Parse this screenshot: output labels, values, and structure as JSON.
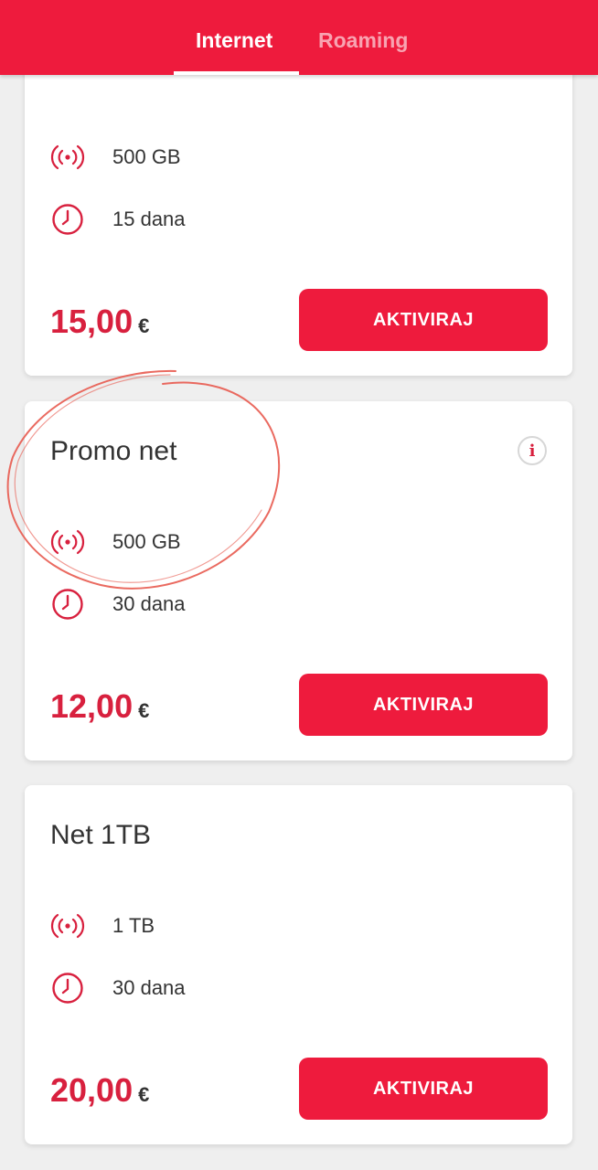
{
  "header": {
    "tabs": [
      {
        "label": "Internet",
        "active": true
      },
      {
        "label": "Roaming",
        "active": false
      }
    ]
  },
  "colors": {
    "brand": "#ee1b3d",
    "price": "#d8203e",
    "annotation": "#e85a4f"
  },
  "cards": [
    {
      "title": "",
      "data_amount": "500 GB",
      "duration": "15 dana",
      "price": "15,00",
      "currency": "€",
      "button": "AKTIVIRAJ"
    },
    {
      "title": "Promo net",
      "info_icon": "i",
      "data_amount": "500 GB",
      "duration": "30 dana",
      "price": "12,00",
      "currency": "€",
      "button": "AKTIVIRAJ"
    },
    {
      "title": "Net 1TB",
      "data_amount": "1 TB",
      "duration": "30 dana",
      "price": "20,00",
      "currency": "€",
      "button": "AKTIVIRAJ"
    }
  ],
  "icons": {
    "data": "signal-broadcast-icon",
    "duration": "clock-icon",
    "info": "info-icon"
  }
}
